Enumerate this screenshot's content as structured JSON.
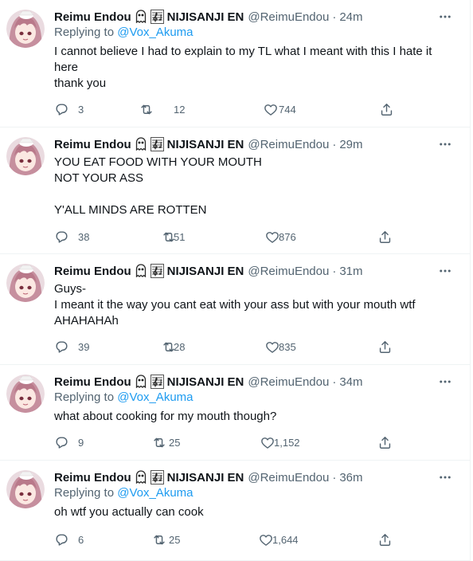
{
  "author": {
    "name": "Reimu Endou",
    "org": "NIJISANJI EN",
    "handle": "@ReimuEndou",
    "emojis": [
      "ghost-emoji",
      "sheet-music-emoji"
    ]
  },
  "colors": {
    "link": "#1d9bf0",
    "muted": "#536471",
    "text": "#0f1419",
    "divider": "#eff3f4"
  },
  "reply_prefix": "Replying to",
  "tweets": [
    {
      "time": "24m",
      "reply_to": "@Vox_Akuma",
      "lines": [
        "I cannot believe I had to explain to my TL what I meant with this I hate it",
        "here",
        "thank you"
      ],
      "replies": "3",
      "retweets": "12",
      "likes": "744"
    },
    {
      "time": "29m",
      "lines": [
        "YOU EAT FOOD WITH YOUR MOUTH",
        "NOT YOUR ASS",
        "",
        "Y'ALL MINDS ARE ROTTEN"
      ],
      "replies": "38",
      "retweets": "51",
      "likes": "876"
    },
    {
      "time": "31m",
      "lines": [
        "Guys-",
        "I meant it the way you cant eat with your ass but with your mouth wtf",
        "AHAHAHAh"
      ],
      "replies": "39",
      "retweets": "28",
      "likes": "835"
    },
    {
      "time": "34m",
      "reply_to": "@Vox_Akuma",
      "lines": [
        "what about cooking for my mouth though?"
      ],
      "replies": "9",
      "retweets": "25",
      "likes": "1,152"
    },
    {
      "time": "36m",
      "reply_to": "@Vox_Akuma",
      "lines": [
        "oh wtf you actually can cook"
      ],
      "replies": "6",
      "retweets": "25",
      "likes": "1,644"
    }
  ]
}
